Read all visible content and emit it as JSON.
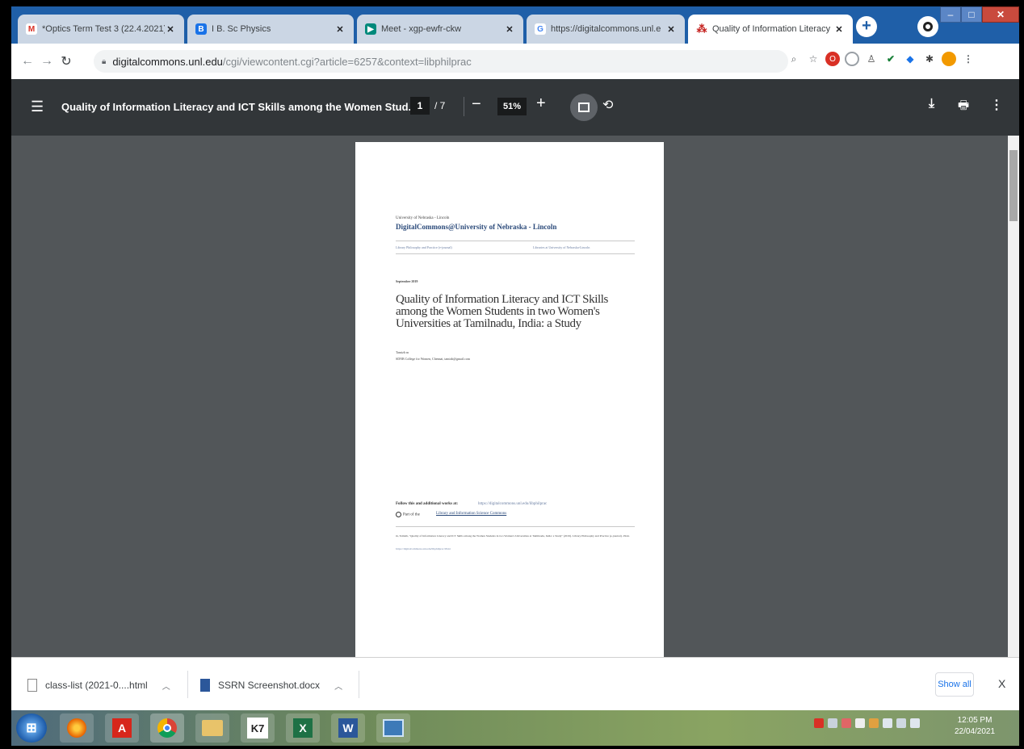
{
  "tabs": [
    {
      "title": "*Optics Term Test 3 (22.4.2021)",
      "favicon": "gmail-icon",
      "color": "#d93025",
      "glyph": "M"
    },
    {
      "title": "I B. Sc Physics",
      "favicon": "classroom-icon",
      "color": "#1a73e8",
      "glyph": "B"
    },
    {
      "title": "Meet - xgp-ewfr-ckw",
      "favicon": "meet-icon",
      "color": "#00897b",
      "glyph": "▶"
    },
    {
      "title": "https://digitalcommons.unl.e",
      "favicon": "google-icon",
      "color": "#4285f4",
      "glyph": "G"
    },
    {
      "title": "Quality of Information Literacy",
      "favicon": "bepress-icon",
      "color": "#c5221f",
      "glyph": "⁂"
    }
  ],
  "address": {
    "host": "digitalcommons.unl.edu",
    "path": "/cgi/viewcontent.cgi?article=6257&context=libphilprac"
  },
  "pdf": {
    "title": "Quality of Information Literacy and ICT Skills among the Women Stud...",
    "page": "1",
    "total": "/ 7",
    "zoom": "51%"
  },
  "page": {
    "university": "University of Nebraska - Lincoln",
    "repository": "DigitalCommons@University of Nebraska - Lincoln",
    "series_left": "Library Philosophy and Practice (e-journal)",
    "series_right": "Libraries at University of Nebraska-Lincoln",
    "date": "September 2019",
    "title": "Quality of Information Literacy and ICT Skills among the Women Students in two Women's Universities at Tamilnadu, India: a Study",
    "author": "Tamizh m",
    "affiliation": "SDNB College for Women, Chennai, tamizh@gmail.com",
    "follow_label": "Follow this and additional works at:",
    "follow_link": "https://digitalcommons.unl.edu/libphilprac",
    "partof_label": "Part of the",
    "partof_link": "Library and Information Science Commons",
    "citation": "m, Tamizh, \"Quality of Information Literacy and ICT Skills among the Women Students in two Women's Universities at Tamilnadu, India: a Study\" (2019). Library Philosophy and Practice (e-journal). 2944.",
    "citation_url": "https://digitalcommons.unl.edu/libphilprac/2944"
  },
  "downloads": [
    {
      "name": "class-list (2021-0....html",
      "type": "html"
    },
    {
      "name": "SSRN Screenshot.docx",
      "type": "docx"
    }
  ],
  "shelf": {
    "show_all": "Show all",
    "close": "X"
  },
  "taskbar": {
    "apps": [
      {
        "name": "start-button",
        "glyph": ""
      },
      {
        "name": "firefox-icon",
        "glyph": "●",
        "color": "#e66000"
      },
      {
        "name": "acrobat-icon",
        "glyph": "A",
        "color": "#d7261b"
      },
      {
        "name": "chrome-icon",
        "glyph": "◉",
        "color": "#4285f4"
      },
      {
        "name": "explorer-icon",
        "glyph": "▤",
        "color": "#e8c36a"
      },
      {
        "name": "k7-icon",
        "glyph": "K7",
        "color": "#333"
      },
      {
        "name": "excel-icon",
        "glyph": "X",
        "color": "#1e7145"
      },
      {
        "name": "word-icon",
        "glyph": "W",
        "color": "#2b579a"
      },
      {
        "name": "snipping-icon",
        "glyph": "✂",
        "color": "#3d7ab8"
      }
    ],
    "time": "12:05 PM",
    "date": "22/04/2021"
  }
}
